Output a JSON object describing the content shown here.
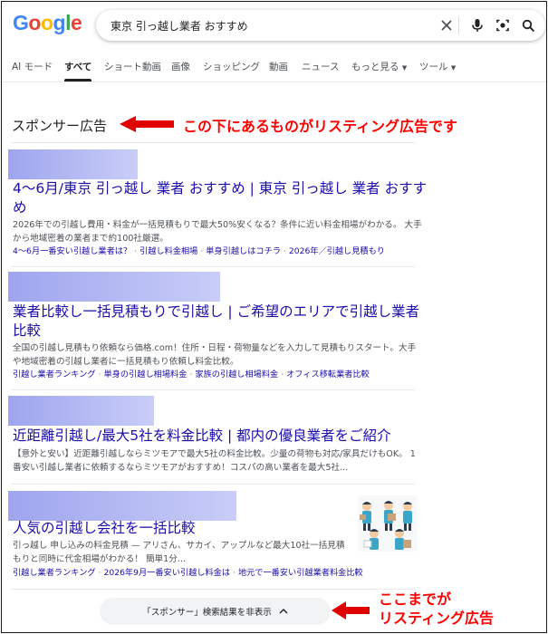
{
  "header": {
    "logo": "Google",
    "query": "東京 引っ越し業者 おすすめ"
  },
  "tabs": [
    {
      "label": "AI モード"
    },
    {
      "label": "すべて"
    },
    {
      "label": "ショート動画"
    },
    {
      "label": "画像"
    },
    {
      "label": "ショッピング"
    },
    {
      "label": "動画"
    },
    {
      "label": "ニュース"
    },
    {
      "label": "もっと見る"
    },
    {
      "label": "ツール"
    }
  ],
  "sponsor": {
    "heading": "スポンサー広告",
    "annotation_top": "この下にあるものがリスティング広告です",
    "annotation_bottom_1": "ここまでが",
    "annotation_bottom_2": "リスティング広告"
  },
  "ads": [
    {
      "title_1": "4〜6月/東京 引っ越し 業者 おすすめ | 東京 引っ越し 業者 おすす",
      "title_2": "め",
      "desc_1": "2026年での引越し費用・料金が一括見積もりで最大50%安くなる？条件に近い料金相場がわかる。 大手",
      "desc_2": "から地域密着の業者まで約100社厳選。",
      "links": [
        "4〜6月一番安い引越し業者は？",
        "引越し料金相場",
        "単身引越しはコチラ",
        "2026年／引越し見積もり"
      ]
    },
    {
      "title_1": "業者比較し一括見積もりで引越し | ご希望のエリアで引越し業者",
      "title_2": "比較",
      "desc_1": "全国の引越し見積もり依頼なら価格.com！住所・日程・荷物量などを入力して見積もりスタート。大手",
      "desc_2": "や地域密着の引越し業者に一括見積もり依頼し料金比較。",
      "links": [
        "引越し業者ランキング",
        "単身の引越し相場料金",
        "家族の引越し相場料金",
        "オフィス移転業者比較"
      ]
    },
    {
      "title_1": "近距離引越し/最大5社を料金比較 | 都内の優良業者をご紹介",
      "desc_1": "【意外と安い】近距離引越しならミツモアで最大5社の料金比較。少量の荷物も対応/家具だけもOK。 1",
      "desc_2": "番安い引越し業者に依頼するならミツモアがおすすめ！コスパの高い業者を最大5社..."
    },
    {
      "title_1": "人気の引越し会社を一括比較",
      "desc_1": "引っ越し 申し込みの料金見積 — アリさん、サカイ、アップルなど最大10社一括見積",
      "desc_2": "もりと同時に代金相場がわかる！ 簡単1分...",
      "links": [
        "引越し業者ランキング",
        "2026年9月一番安い引越し料金は",
        "地元で一番安い引越業者料金比較"
      ]
    }
  ],
  "hide_button": {
    "label": "「スポンサー」検索結果を非表示"
  },
  "colors": {
    "link": "#1a0dab",
    "annotation": "#ff0000",
    "blur": "#a8aef0"
  },
  "icons": [
    "close-icon",
    "mic-icon",
    "lens-icon",
    "search-icon",
    "arrow-left-icon",
    "chevron-up-icon"
  ]
}
